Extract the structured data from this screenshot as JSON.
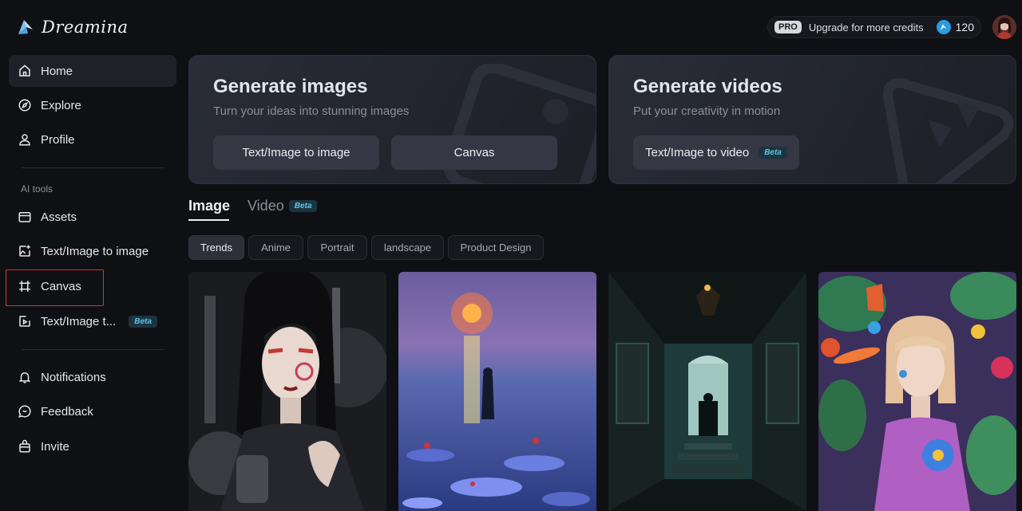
{
  "app": {
    "name": "Dreamina"
  },
  "sidebar": {
    "items": [
      {
        "label": "Home"
      },
      {
        "label": "Explore"
      },
      {
        "label": "Profile"
      }
    ],
    "section_label": "AI tools",
    "tools": [
      {
        "label": "Assets"
      },
      {
        "label": "Text/Image to image"
      },
      {
        "label": "Canvas"
      },
      {
        "label": "Text/Image t...",
        "badge": "Beta"
      }
    ],
    "bottom": [
      {
        "label": "Notifications"
      },
      {
        "label": "Feedback"
      },
      {
        "label": "Invite"
      }
    ]
  },
  "header": {
    "pro_badge": "PRO",
    "upgrade_label": "Upgrade for more credits",
    "credits": "120"
  },
  "hero": {
    "images": {
      "title": "Generate images",
      "subtitle": "Turn your ideas into stunning images",
      "buttons": [
        "Text/Image to image",
        "Canvas"
      ]
    },
    "videos": {
      "title": "Generate videos",
      "subtitle": "Put your creativity in motion",
      "button": "Text/Image to video",
      "badge": "Beta"
    }
  },
  "tabs": [
    {
      "label": "Image"
    },
    {
      "label": "Video",
      "badge": "Beta"
    }
  ],
  "chips": [
    "Trends",
    "Anime",
    "Portrait",
    "landscape",
    "Product Design"
  ],
  "colors": {
    "background": "#0f1014",
    "accent": "#2c9be0",
    "beta": "#5cc8e6",
    "highlight": "#e0302a"
  }
}
